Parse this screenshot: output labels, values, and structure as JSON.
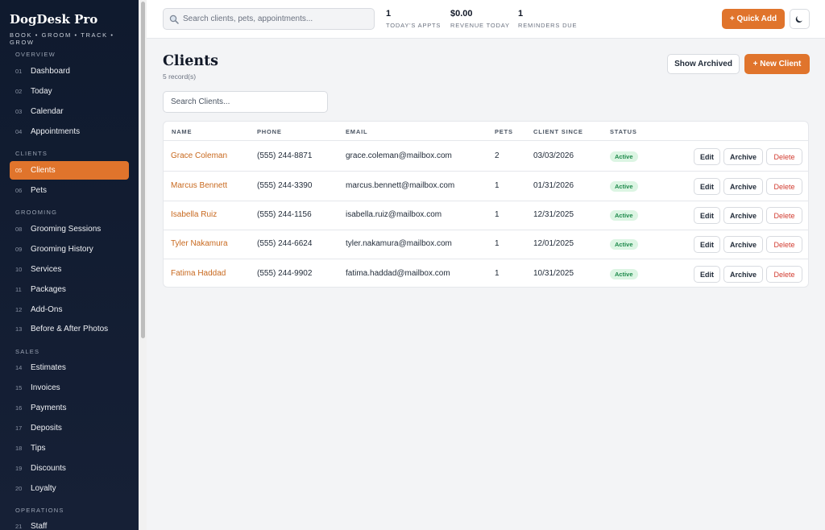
{
  "app": {
    "brand": "DogDesk Pro",
    "tagline": "BOOK • GROOM • TRACK • GROW",
    "accent_color": "#e0742c"
  },
  "sidebar": {
    "sections": [
      {
        "title": "OVERVIEW"
      },
      {
        "title": "CLIENTS"
      },
      {
        "title": "GROOMING"
      },
      {
        "title": "SALES"
      },
      {
        "title": "OPERATIONS"
      }
    ],
    "items": [
      {
        "num": "01",
        "label": "Dashboard"
      },
      {
        "num": "02",
        "label": "Today"
      },
      {
        "num": "03",
        "label": "Calendar"
      },
      {
        "num": "04",
        "label": "Appointments"
      },
      {
        "num": "05",
        "label": "Clients",
        "active": true
      },
      {
        "num": "06",
        "label": "Pets"
      },
      {
        "num": "08",
        "label": "Grooming Sessions"
      },
      {
        "num": "09",
        "label": "Grooming History"
      },
      {
        "num": "10",
        "label": "Services"
      },
      {
        "num": "11",
        "label": "Packages"
      },
      {
        "num": "12",
        "label": "Add-Ons"
      },
      {
        "num": "13",
        "label": "Before & After Photos"
      },
      {
        "num": "14",
        "label": "Estimates"
      },
      {
        "num": "15",
        "label": "Invoices"
      },
      {
        "num": "16",
        "label": "Payments"
      },
      {
        "num": "17",
        "label": "Deposits"
      },
      {
        "num": "18",
        "label": "Tips"
      },
      {
        "num": "19",
        "label": "Discounts"
      },
      {
        "num": "20",
        "label": "Loyalty"
      },
      {
        "num": "21",
        "label": "Staff"
      }
    ]
  },
  "header": {
    "search_placeholder": "Search clients, pets, appointments...",
    "stats": [
      {
        "value": "1",
        "label": "TODAY'S APPTS"
      },
      {
        "value": "$0.00",
        "label": "REVENUE TODAY"
      },
      {
        "value": "1",
        "label": "REMINDERS DUE"
      }
    ],
    "quick_add_label": "+ Quick Add",
    "theme_icon": "moon-icon"
  },
  "main": {
    "title": "Clients",
    "record_count": "5 record(s)",
    "show_archived_label": "Show Archived",
    "new_client_label": "+ New Client",
    "search_placeholder": "Search Clients...",
    "table": {
      "columns": [
        "NAME",
        "PHONE",
        "EMAIL",
        "PETS",
        "CLIENT SINCE",
        "STATUS"
      ],
      "rows": [
        {
          "name": "Grace Coleman",
          "phone": "(555) 244-8871",
          "email": "grace.coleman@mailbox.com",
          "pets": "2",
          "since": "03/03/2026",
          "status": "Active"
        },
        {
          "name": "Marcus Bennett",
          "phone": "(555) 244-3390",
          "email": "marcus.bennett@mailbox.com",
          "pets": "1",
          "since": "01/31/2026",
          "status": "Active"
        },
        {
          "name": "Isabella Ruiz",
          "phone": "(555) 244-1156",
          "email": "isabella.ruiz@mailbox.com",
          "pets": "1",
          "since": "12/31/2025",
          "status": "Active"
        },
        {
          "name": "Tyler Nakamura",
          "phone": "(555) 244-6624",
          "email": "tyler.nakamura@mailbox.com",
          "pets": "1",
          "since": "12/01/2025",
          "status": "Active"
        },
        {
          "name": "Fatima Haddad",
          "phone": "(555) 244-9902",
          "email": "fatima.haddad@mailbox.com",
          "pets": "1",
          "since": "10/31/2025",
          "status": "Active"
        }
      ],
      "actions": {
        "edit": "Edit",
        "archive": "Archive",
        "delete": "Delete"
      }
    }
  }
}
